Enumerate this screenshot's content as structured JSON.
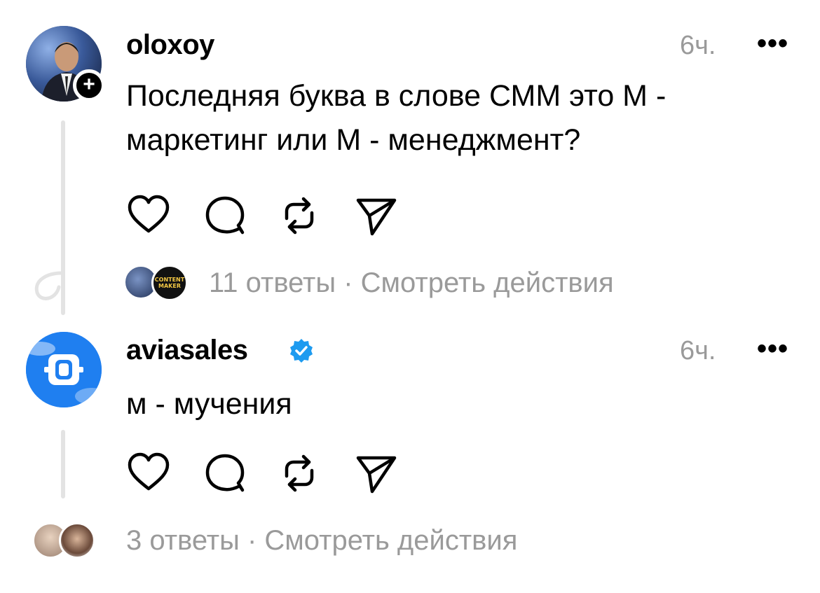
{
  "posts": [
    {
      "username": "oloxoy",
      "time": "6ч.",
      "more": "•••",
      "text_line1": "Последняя буква в слове СММ это М -",
      "text_line2": "маркетинг или М - менеджмент?",
      "replies_text": "11 ответы · Смотреть действия",
      "follow_badge": "+"
    },
    {
      "username": "aviasales",
      "verified": true,
      "time": "6ч.",
      "more": "•••",
      "text_line1": "м - мучения",
      "replies_text": "3 ответы · Смотреть действия"
    }
  ],
  "mini_avatar_label": {
    "line1": "CONTENT",
    "line2": "MAKER"
  },
  "icons": [
    "heart-icon",
    "comment-icon",
    "repost-icon",
    "share-icon"
  ],
  "colors": {
    "muted": "#9a9a9a",
    "verified": "#1d9bf0",
    "aviasales_blue": "#1f7ff0",
    "thread_line": "#e3e3e3"
  }
}
